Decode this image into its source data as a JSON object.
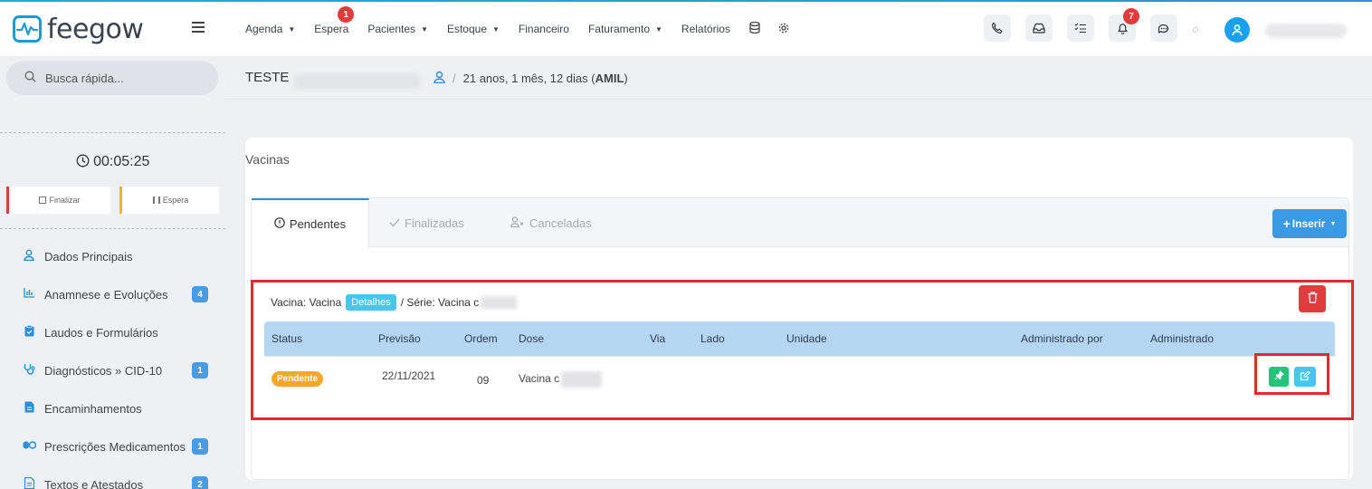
{
  "app": {
    "brand": "feegow"
  },
  "nav": {
    "agenda": "Agenda",
    "espera": "Espera",
    "espera_badge": "1",
    "pacientes": "Pacientes",
    "estoque": "Estoque",
    "financeiro": "Financeiro",
    "faturamento": "Faturamento",
    "relatorios": "Relatórios",
    "caret": "▼"
  },
  "header": {
    "notifications_badge": "7",
    "icons": [
      "phone-icon",
      "inbox-icon",
      "checklist-icon",
      "bell-icon",
      "chat-icon",
      "user-icon"
    ]
  },
  "sidebar": {
    "search_placeholder": "Busca rápida...",
    "timer": "00:05:25",
    "finalizar": "Finalizar",
    "espera": "Espera",
    "items": [
      {
        "label": "Dados Principais",
        "badge": ""
      },
      {
        "label": "Anamnese e Evoluções",
        "badge": "4"
      },
      {
        "label": "Laudos e Formulários",
        "badge": ""
      },
      {
        "label": "Diagnósticos » CID-10",
        "badge": "1"
      },
      {
        "label": "Encaminhamentos",
        "badge": ""
      },
      {
        "label": "Prescrições Medicamentos",
        "badge": "1"
      },
      {
        "label": "Textos e Atestados",
        "badge": "2"
      }
    ]
  },
  "patient": {
    "name": "TESTE",
    "separator": "/",
    "age_prefix": "21 anos, 1 mês, 12 dias (",
    "insurance": "AMIL",
    "age_suffix": ")"
  },
  "card": {
    "title": "Vacinas",
    "tabs": {
      "pendentes": "Pendentes",
      "finalizadas": "Finalizadas",
      "canceladas": "Canceladas"
    },
    "inserir": "Inserir",
    "vaccine": {
      "prefix": "Vacina: Vacina",
      "detalhes": "Detalhes",
      "serie": "/ Série: Vacina c"
    },
    "table": {
      "headers": {
        "status": "Status",
        "previsao": "Previsão",
        "ordem": "Ordem",
        "dose": "Dose",
        "via": "Via",
        "lado": "Lado",
        "unidade": "Unidade",
        "administrado_por": "Administrado por",
        "administrado": "Administrado"
      },
      "row": {
        "status": "Pendente",
        "previsao": "22/11/2021",
        "ordem": "09",
        "dose": "Vacina c"
      }
    }
  },
  "colors": {
    "accent": "#2b8ed8",
    "danger": "#e23b3b",
    "success": "#25c27a",
    "info": "#48c6ee",
    "warning": "#f3a927"
  }
}
